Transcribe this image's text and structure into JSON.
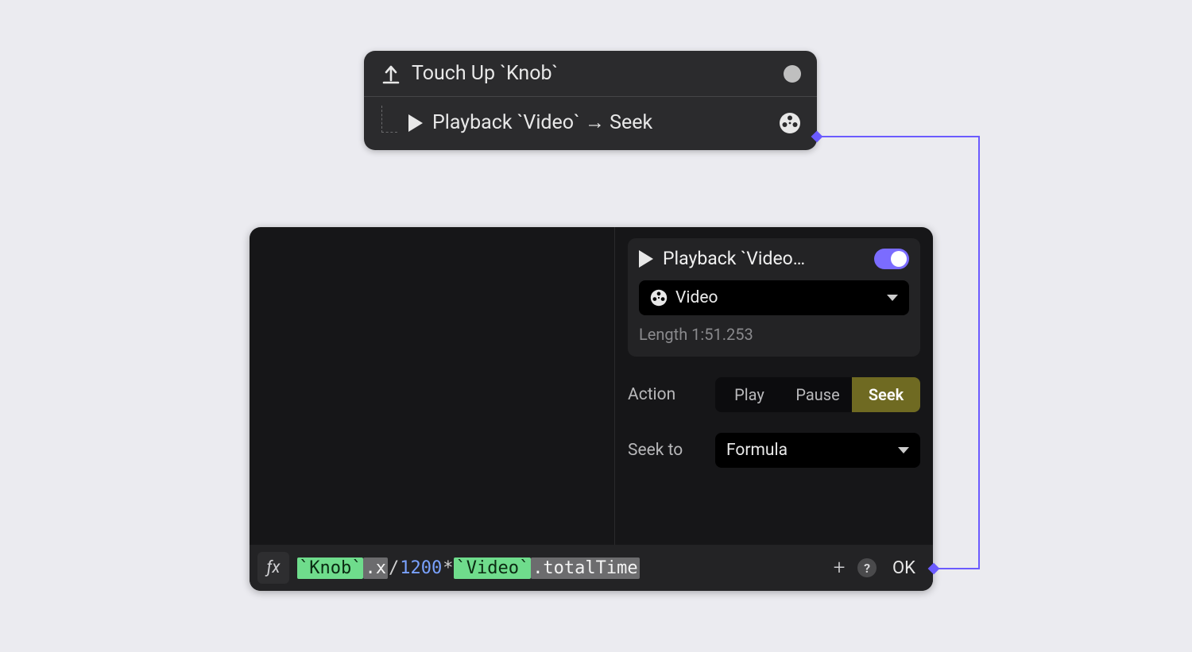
{
  "colors": {
    "accent": "#6b5bff"
  },
  "node": {
    "header": {
      "text": "Touch Up `Knob`"
    },
    "row": {
      "label": "Playback `Video` → Seek"
    }
  },
  "panel": {
    "group": {
      "title": "Playback `Video…",
      "select_label": "Video",
      "length_label": "Length 1:51.253"
    },
    "action": {
      "label": "Action",
      "options": [
        "Play",
        "Pause",
        "Seek"
      ],
      "active": "Seek"
    },
    "seek": {
      "label": "Seek to",
      "mode": "Formula"
    },
    "formula": {
      "tokens": [
        {
          "t": "ref",
          "v": "`Knob`"
        },
        {
          "t": "prop",
          "v": ".x"
        },
        {
          "t": "op",
          "v": "/"
        },
        {
          "t": "num",
          "v": "1200"
        },
        {
          "t": "op",
          "v": "*"
        },
        {
          "t": "ref",
          "v": "`Video`"
        },
        {
          "t": "prop",
          "v": ".totalTime"
        }
      ],
      "ok": "OK"
    }
  }
}
